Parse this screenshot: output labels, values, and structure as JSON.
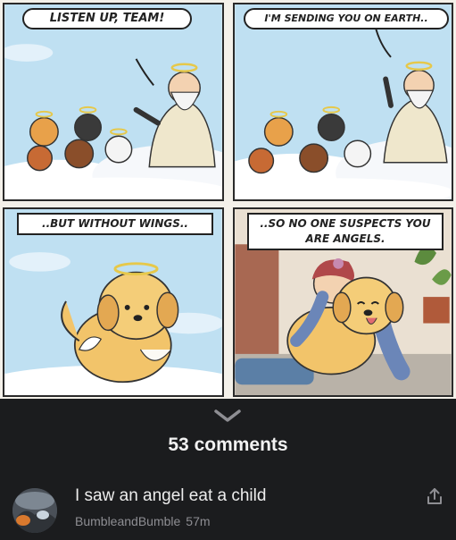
{
  "comic": {
    "panel1_text": "LISTEN UP, TEAM!",
    "panel2_text": "I'M SENDING YOU ON EARTH..",
    "panel3_text": "..BUT WITHOUT WINGS..",
    "panel4_text": "..SO NO ONE SUSPECTS YOU ARE ANGELS."
  },
  "thread": {
    "comments_count_label": "53 comments",
    "expand_icon": "chevron-down-icon"
  },
  "comment": {
    "text": "I saw an angel eat a child",
    "author": "BumbleandBumble",
    "time": "57m",
    "share_icon": "share-icon"
  }
}
